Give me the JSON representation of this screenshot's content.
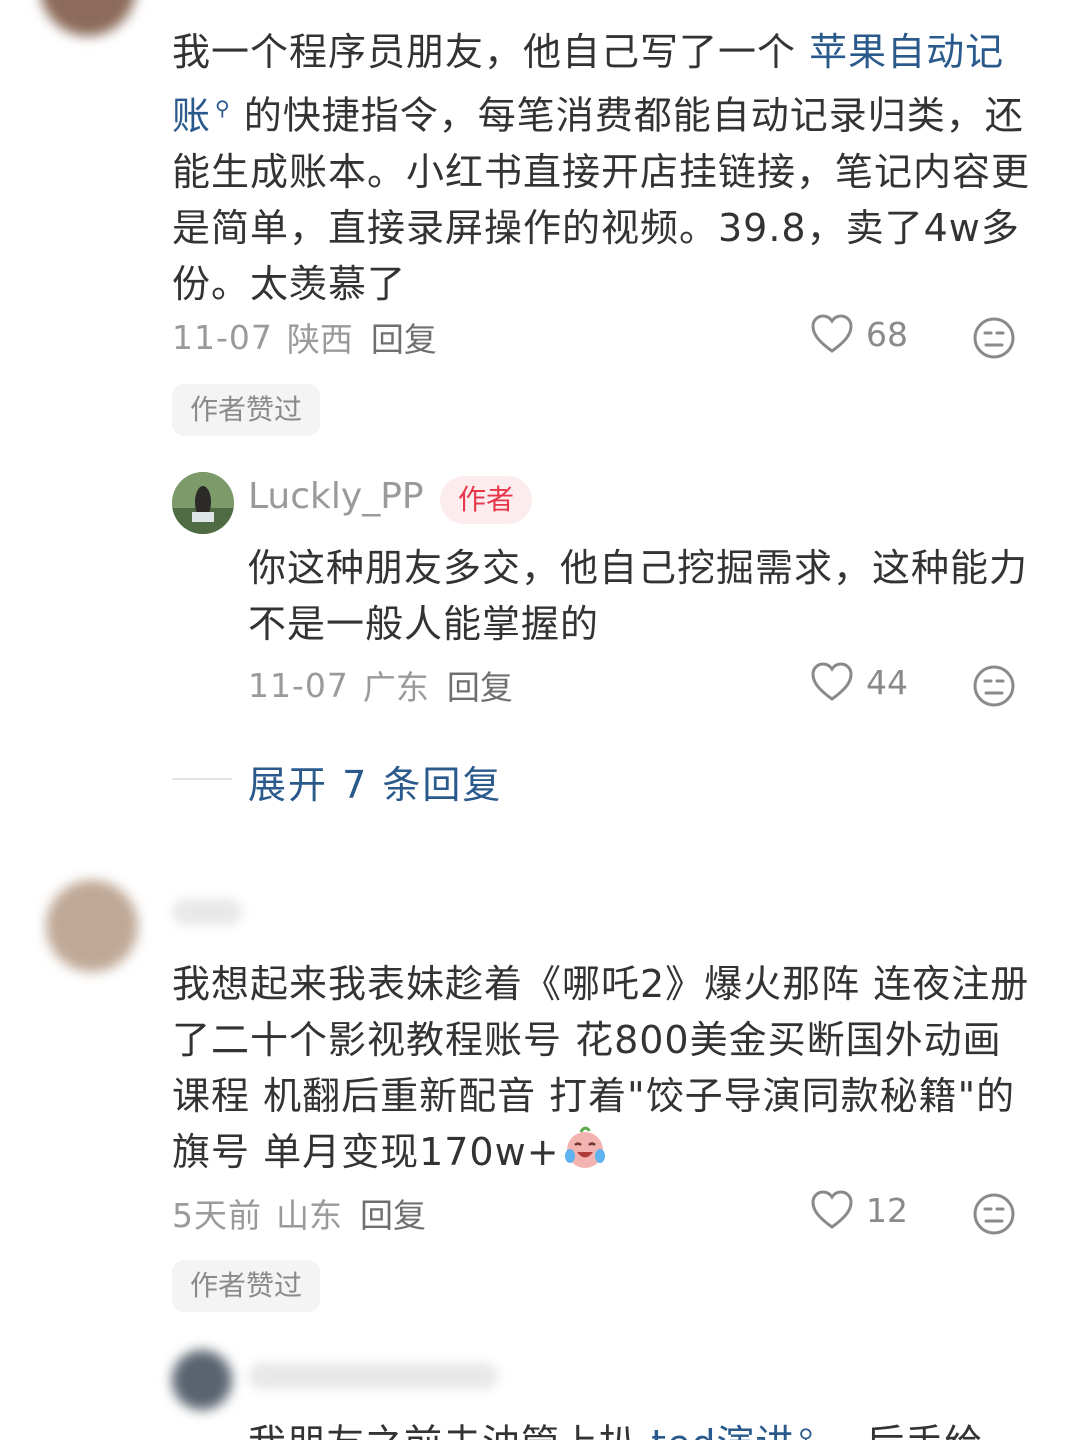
{
  "comments": [
    {
      "text_a": "我一个程序员朋友，他自己写了一个",
      "link_text": "苹果自动记账",
      "text_b": "的快捷指令，每笔消费都能自动记录归类，还能生成账本。小红书直接开店挂链接，笔记内容更是简单，直接录屏操作的视频。39.8，卖了4w多份。太羡慕了",
      "date": "11-07",
      "location": "陕西",
      "reply_label": "回复",
      "likes": "68",
      "badge": "作者赞过",
      "replies": [
        {
          "username": "Luckly_PP",
          "author_tag": "作者",
          "text": "你这种朋友多交，他自己挖掘需求，这种能力不是一般人能掌握的",
          "date": "11-07",
          "location": "广东",
          "reply_label": "回复",
          "likes": "44"
        }
      ],
      "expand_label": "展开 7 条回复"
    },
    {
      "text": "我想起来我表妹趁着《哪吒2》爆火那阵 连夜注册了二十个影视教程账号 花800美金买断国外动画课程 机翻后重新配音 打着\"饺子导演同款秘籍\"的旗号 单月变现170w+",
      "date": "5天前",
      "location": "山东",
      "reply_label": "回复",
      "likes": "12",
      "badge": "作者赞过",
      "replies_preview": {
        "text_a": "我朋友之前去油管上扒",
        "link_text": "ted演讲",
        "text_b": "，后手给"
      }
    }
  ],
  "icons": {
    "heart": "heart-icon",
    "dislike": "dislike-face-icon",
    "search": "search-icon",
    "emoji": "crying-laughing-emoji"
  },
  "colors": {
    "link": "#2a5a8c",
    "author_badge_text": "#e5364b",
    "author_badge_bg": "#fdecee",
    "meta": "#9a9a9a"
  }
}
